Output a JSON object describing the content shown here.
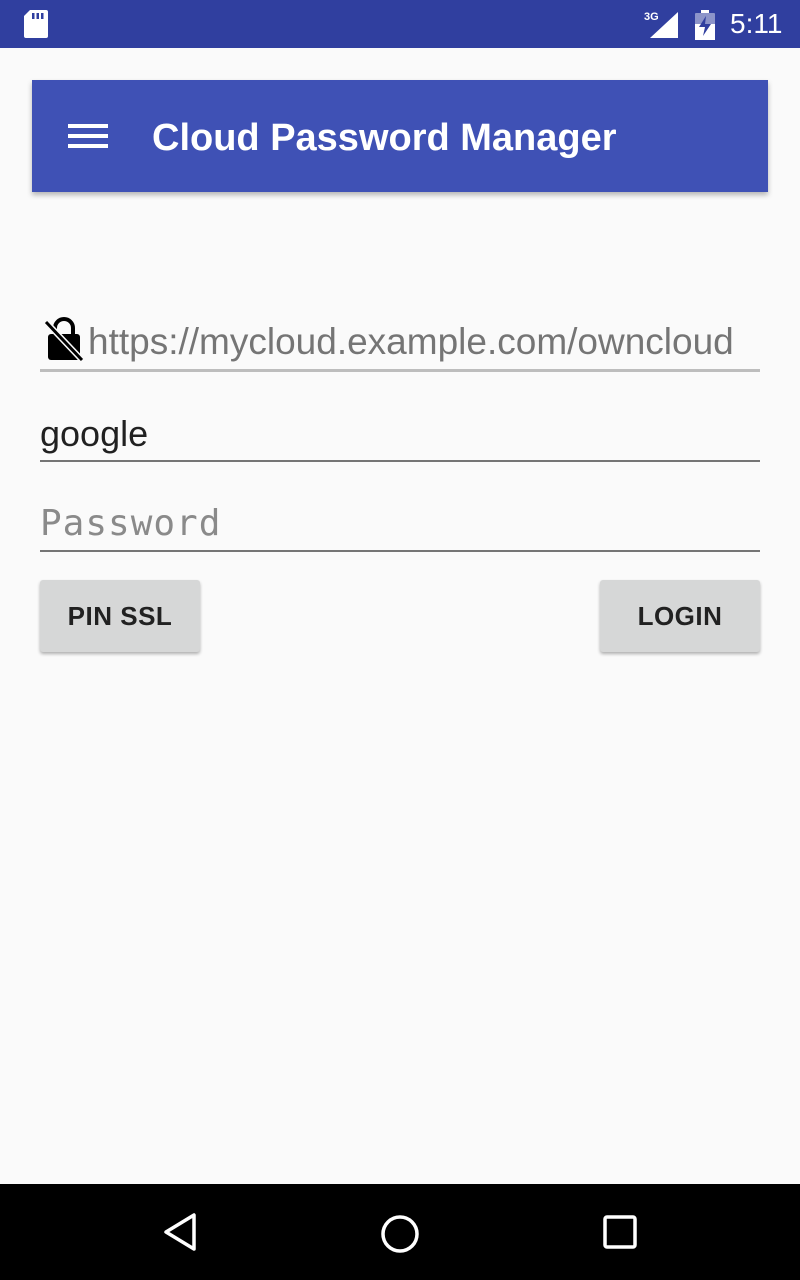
{
  "status_bar": {
    "network_label": "3G",
    "time": "5:11",
    "icons": [
      "sd-card-icon",
      "signal-icon",
      "battery-charging-icon"
    ],
    "background_color": "#303F9F"
  },
  "app_bar": {
    "menu_icon": "hamburger-menu-icon",
    "title": "Cloud Password Manager",
    "background_color": "#3F51B5"
  },
  "form": {
    "url": {
      "icon": "unlocked-lock-icon",
      "value": "",
      "placeholder": "https://mycloud.example.com/owncloud"
    },
    "username": {
      "value": "google"
    },
    "password": {
      "value": "",
      "placeholder": "Password"
    }
  },
  "buttons": {
    "pin_ssl": "PIN SSL",
    "login": "LOGIN"
  },
  "nav_bar": {
    "icons": [
      "back-icon",
      "home-icon",
      "recents-icon"
    ]
  }
}
